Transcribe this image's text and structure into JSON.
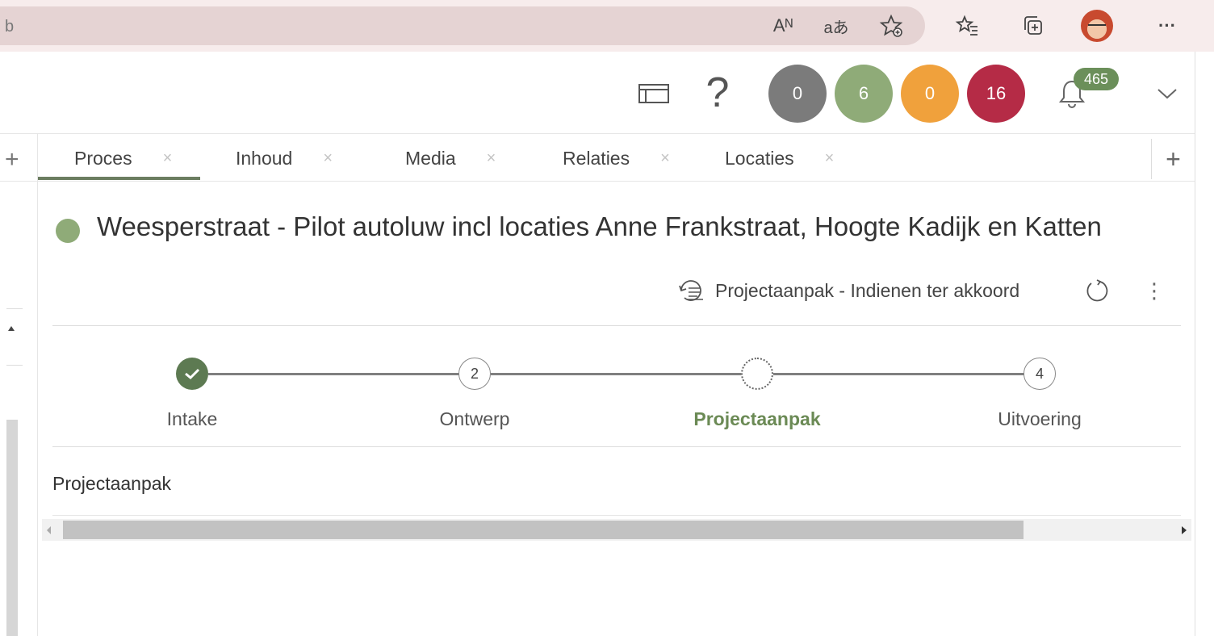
{
  "browser": {
    "address_fragment": "b",
    "icons": [
      "read-aloud-icon",
      "translate-icon",
      "add-favorite-icon",
      "favorites-icon",
      "collections-icon",
      "profile-avatar",
      "more-icon"
    ],
    "read_aloud_glyph": "Aᴺ",
    "translate_glyph": "aあ",
    "more_glyph": "···"
  },
  "header": {
    "help_glyph": "?",
    "counters": [
      {
        "value": "0",
        "color": "#7b7b7b"
      },
      {
        "value": "6",
        "color": "#8fab78"
      },
      {
        "value": "0",
        "color": "#f0a13c"
      },
      {
        "value": "16",
        "color": "#b52b46"
      }
    ],
    "notifications_count": "465"
  },
  "tabs": [
    {
      "label": "Proces",
      "active": true
    },
    {
      "label": "Inhoud",
      "active": false
    },
    {
      "label": "Media",
      "active": false
    },
    {
      "label": "Relaties",
      "active": false
    },
    {
      "label": "Locaties",
      "active": false
    }
  ],
  "tab_close_glyph": "×",
  "tab_add_glyph": "+",
  "project": {
    "title": "Weesperstraat - Pilot autoluw incl locaties Anne Frankstraat, Hoogte Kadijk en Katten",
    "status_color": "#8fab78",
    "workflow_status": "Projectaanpak - Indienen ter akkoord",
    "more_glyph": "⋮"
  },
  "stepper": {
    "steps": [
      {
        "label": "Intake",
        "number": "",
        "state": "done"
      },
      {
        "label": "Ontwerp",
        "number": "2",
        "state": "todo"
      },
      {
        "label": "Projectaanpak",
        "number": "",
        "state": "current"
      },
      {
        "label": "Uitvoering",
        "number": "4",
        "state": "todo"
      }
    ]
  },
  "section": {
    "label": "Projectaanpak"
  }
}
